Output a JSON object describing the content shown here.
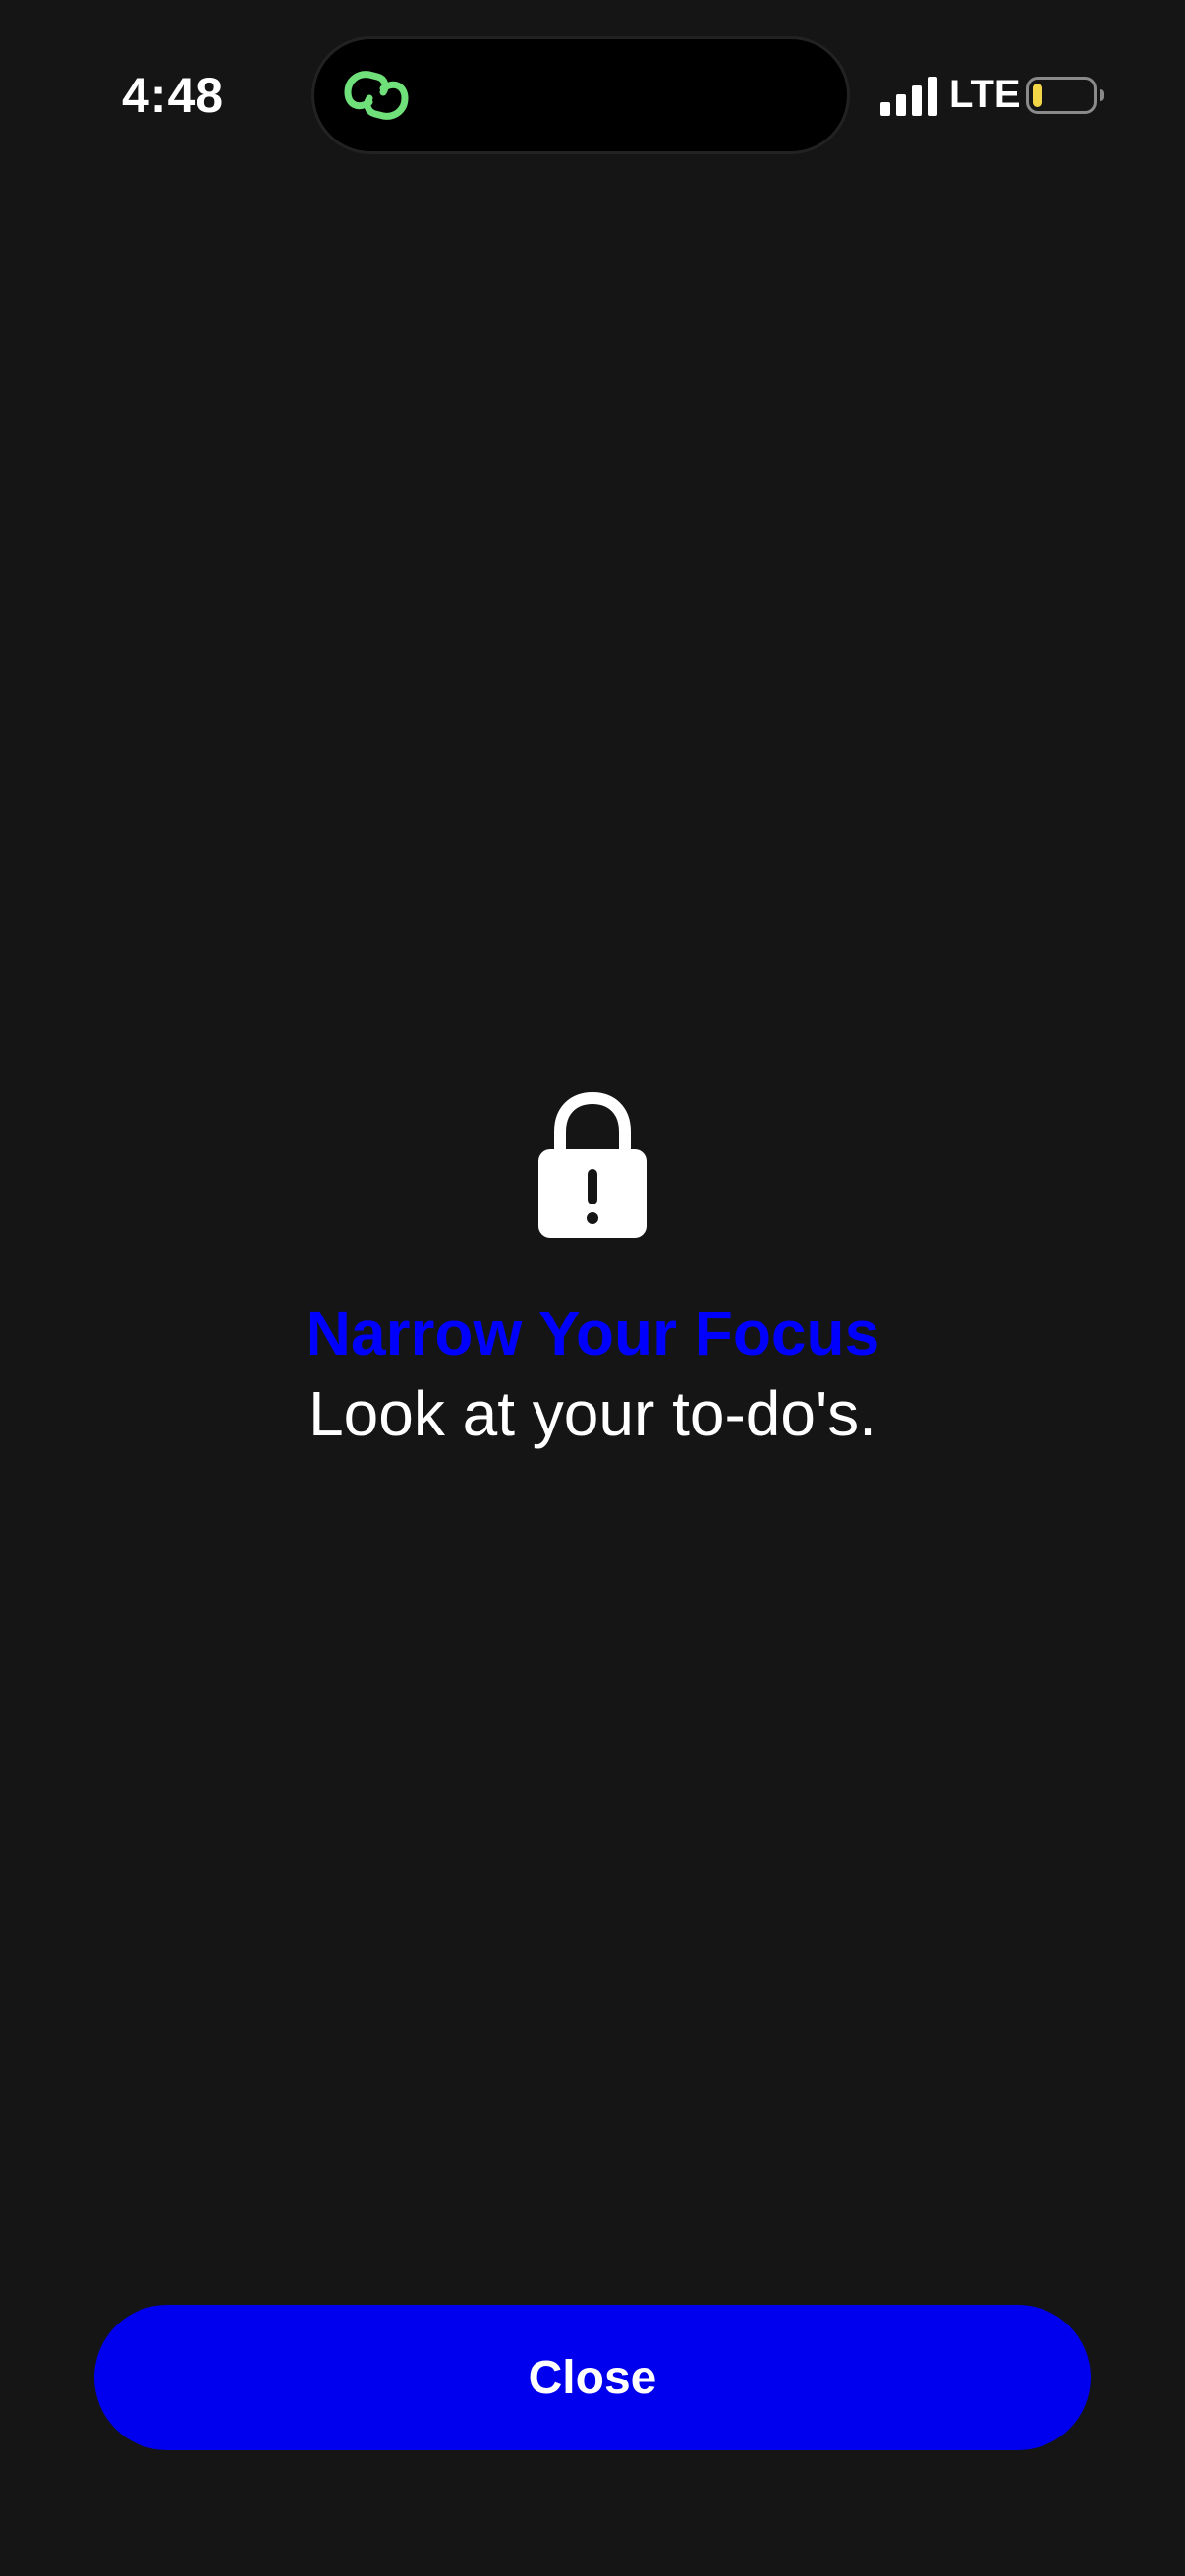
{
  "status_bar": {
    "time": "4:48",
    "network": "LTE",
    "battery_level": 0.15,
    "battery_color": "#f3d548",
    "island_icon": "link-icon",
    "island_icon_color": "#6fe07a"
  },
  "main": {
    "icon": "lock-exclamation-icon",
    "title": "Narrow Your Focus",
    "subtitle": "Look at your to-do's.",
    "accent_color": "#0000ff"
  },
  "close_button": {
    "label": "Close"
  }
}
